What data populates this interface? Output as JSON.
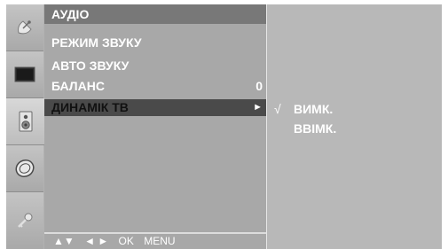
{
  "sidebar": {
    "icons": [
      {
        "name": "satellite-dish-icon"
      },
      {
        "name": "monitor-icon"
      },
      {
        "name": "speaker-icon",
        "active": true
      },
      {
        "name": "clock-icon"
      },
      {
        "name": "key-icon"
      }
    ]
  },
  "menu": {
    "title": "АУДІО",
    "items": [
      {
        "label": "РЕЖИМ ЗВУКУ",
        "value": ""
      },
      {
        "label": "АВТО ЗВУКУ",
        "value": ""
      },
      {
        "label": "БАЛАНС",
        "value": "0"
      },
      {
        "label": "ДИНАМІК ТВ",
        "value": "►",
        "selected": true
      }
    ],
    "footer": {
      "updown": "▲▼",
      "leftright": "◄ ►",
      "ok": "OK",
      "menu": "MENU"
    }
  },
  "submenu": {
    "options": [
      {
        "check": "√",
        "label": "ВИМК."
      },
      {
        "check": "",
        "label": "ВВІМК."
      }
    ]
  },
  "colors": {
    "title_bar": "#787878",
    "menu_bg": "#a8a8a8",
    "selected_row": "#4a4a4a",
    "submenu_bg": "#b8b8b8"
  }
}
